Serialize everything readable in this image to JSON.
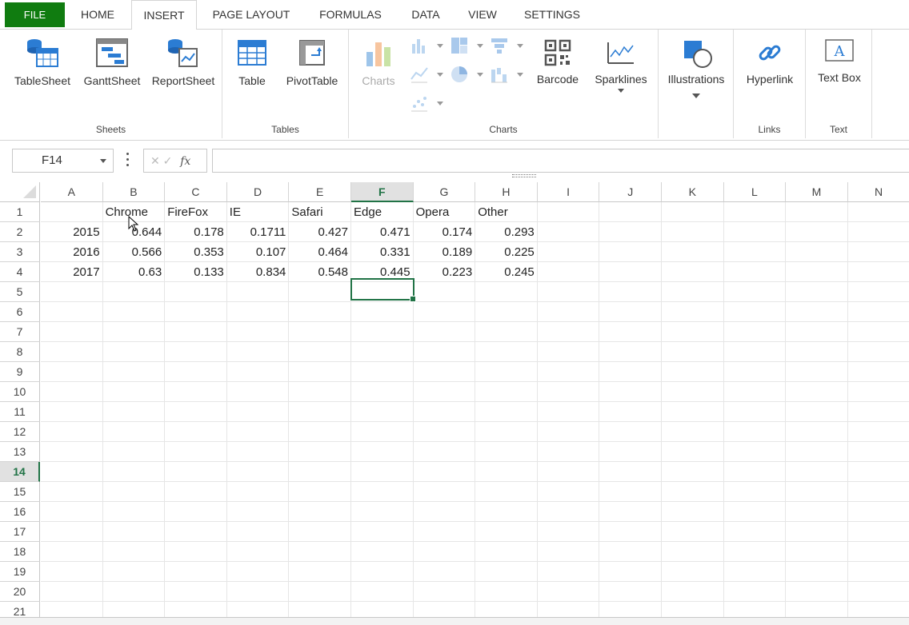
{
  "tabs": [
    {
      "label": "FILE"
    },
    {
      "label": "HOME"
    },
    {
      "label": "INSERT"
    },
    {
      "label": "PAGE LAYOUT"
    },
    {
      "label": "FORMULAS"
    },
    {
      "label": "DATA"
    },
    {
      "label": "VIEW"
    },
    {
      "label": "SETTINGS"
    }
  ],
  "ribbon": {
    "sheets": {
      "label": "Sheets",
      "buttons": [
        "TableSheet",
        "GanttSheet",
        "ReportSheet"
      ]
    },
    "tables": {
      "label": "Tables",
      "buttons": [
        "Table",
        "PivotTable"
      ]
    },
    "charts": {
      "label": "Charts",
      "charts_button": "Charts",
      "barcode": "Barcode",
      "sparklines": "Sparklines"
    },
    "illustrations": {
      "button": "Illustrations"
    },
    "links": {
      "label": "Links",
      "button": "Hyperlink"
    },
    "text": {
      "label": "Text",
      "button": "Text Box"
    }
  },
  "formula_bar": {
    "name_box": "F14",
    "fx": "fx",
    "value": ""
  },
  "columns": [
    "A",
    "B",
    "C",
    "D",
    "E",
    "F",
    "G",
    "H",
    "I",
    "J",
    "K",
    "L",
    "M",
    "N"
  ],
  "rows": [
    "1",
    "2",
    "3",
    "4",
    "5",
    "6",
    "7",
    "8",
    "9",
    "10",
    "11",
    "12",
    "13",
    "14",
    "15",
    "16",
    "17",
    "18",
    "19",
    "20",
    "21"
  ],
  "selected": {
    "column": "F",
    "row": "14"
  },
  "table": {
    "headers": [
      "",
      "Chrome",
      "FireFox",
      "IE",
      "Safari",
      "Edge",
      "Opera",
      "Other"
    ],
    "data": [
      [
        "2015",
        "0.644",
        "0.178",
        "0.1711",
        "0.427",
        "0.471",
        "0.174",
        "0.293"
      ],
      [
        "2016",
        "0.566",
        "0.353",
        "0.107",
        "0.464",
        "0.331",
        "0.189",
        "0.225"
      ],
      [
        "2017",
        "0.63",
        "0.133",
        "0.834",
        "0.548",
        "0.445",
        "0.223",
        "0.245"
      ]
    ]
  },
  "colors": {
    "accent": "#217346",
    "file_tab": "#107c10"
  }
}
